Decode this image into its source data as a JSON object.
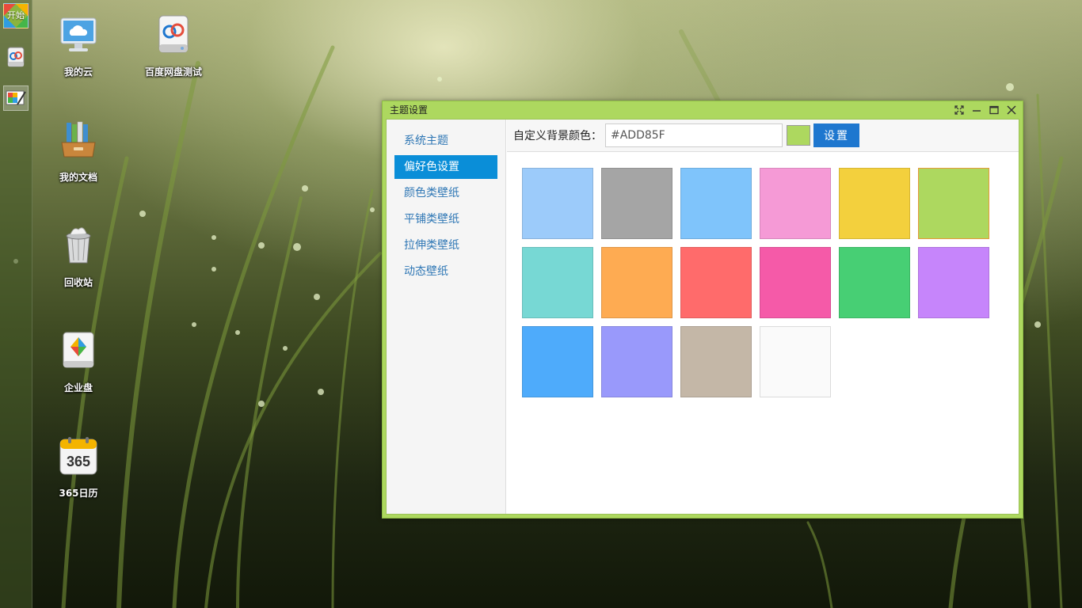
{
  "taskbar": {
    "start_label": "开始",
    "items": [
      {
        "icon": "baidu-pan-icon"
      },
      {
        "icon": "theme-palette-icon"
      }
    ]
  },
  "desktop": {
    "icons": [
      {
        "label": "我的云",
        "icon": "cloud-monitor-icon"
      },
      {
        "label": "百度网盘测试",
        "icon": "baidu-pan-icon"
      },
      {
        "label": "我的文档",
        "icon": "documents-icon"
      },
      {
        "label": "回收站",
        "icon": "recycle-bin-icon"
      },
      {
        "label": "企业盘",
        "icon": "enterprise-disk-icon"
      },
      {
        "label": "365日历",
        "icon": "calendar-icon"
      }
    ]
  },
  "window": {
    "title": "主题设置",
    "sidebar": [
      {
        "label": "系统主题"
      },
      {
        "label": "偏好色设置",
        "active": true
      },
      {
        "label": "颜色类壁纸"
      },
      {
        "label": "平铺类壁纸"
      },
      {
        "label": "拉伸类壁纸"
      },
      {
        "label": "动态壁纸"
      }
    ],
    "toolbar": {
      "label": "自定义背景颜色：",
      "value": "#ADD85F",
      "preview_color": "#add85f",
      "button": "设置"
    },
    "swatches": [
      "#9ccbfa",
      "#a5a5a5",
      "#7fc4fb",
      "#f59ad6",
      "#f3d03d",
      "#add85f",
      "#77d8d4",
      "#feab52",
      "#ff6b6b",
      "#f55aa8",
      "#47cf74",
      "#c685fb",
      "#4eabfb",
      "#9999fb",
      "#c4b7a7",
      "#fafafa"
    ],
    "selected_swatch": 5
  }
}
